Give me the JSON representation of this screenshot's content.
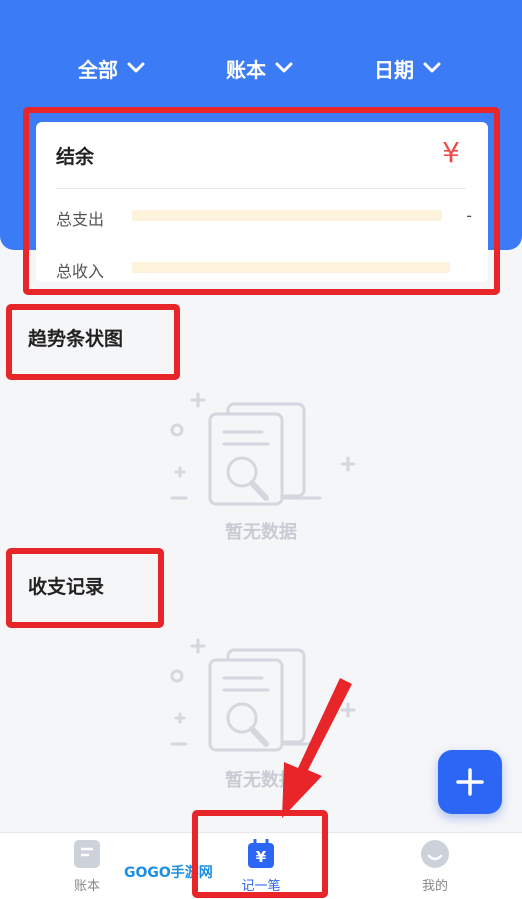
{
  "filters": [
    {
      "label": "全部"
    },
    {
      "label": "账本"
    },
    {
      "label": "日期"
    }
  ],
  "summary": {
    "title": "结余",
    "currency_symbol": "¥",
    "expense_label": "总支出",
    "expense_value": "-",
    "income_label": "总收入"
  },
  "trend": {
    "title": "趋势条状图",
    "empty_text": "暂无数据"
  },
  "records": {
    "title": "收支记录",
    "empty_text": "暂无数据"
  },
  "fab": {
    "icon": "plus-icon"
  },
  "nav": {
    "items": [
      {
        "label": "账本",
        "icon": "ledger-icon"
      },
      {
        "label": "记一笔",
        "icon": "record-icon"
      },
      {
        "label": "我的",
        "icon": "profile-icon"
      }
    ]
  },
  "watermark": "GOGO手游网",
  "colors": {
    "primary": "#3b7bf6",
    "accent_red": "#f24b4b",
    "highlight": "#e8262a"
  }
}
